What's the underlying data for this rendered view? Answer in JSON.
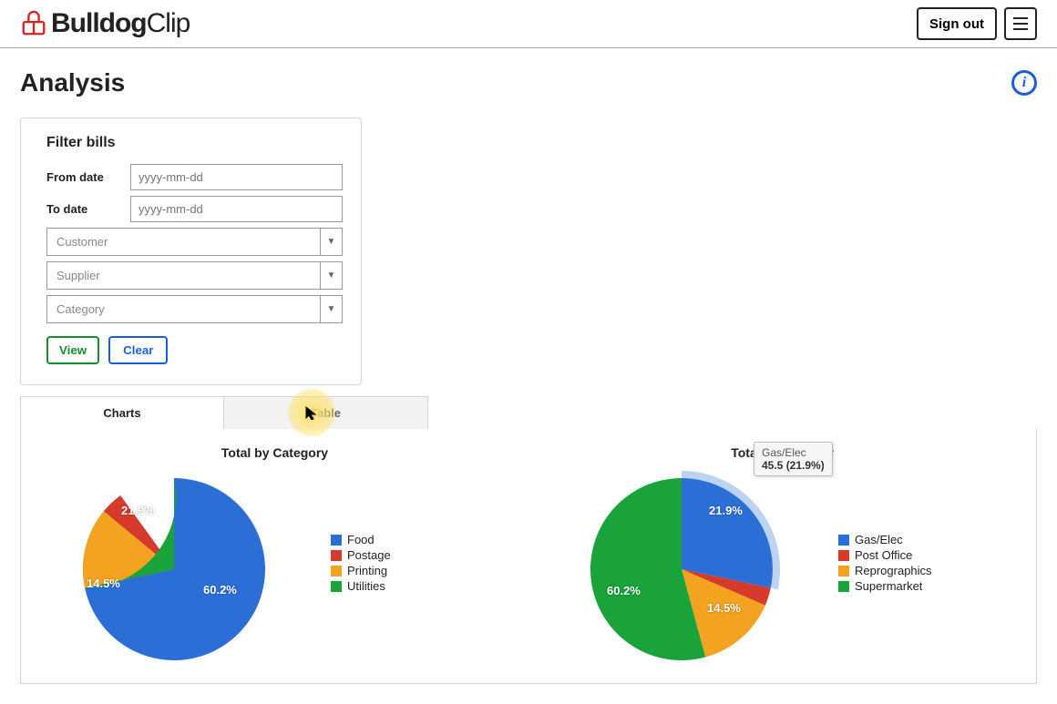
{
  "header": {
    "brand_bold": "Bulldog",
    "brand_light": "Clip",
    "signout": "Sign out"
  },
  "page": {
    "title": "Analysis"
  },
  "filter": {
    "panel_title": "Filter bills",
    "from_label": "From date",
    "from_placeholder": "yyyy-mm-dd",
    "to_label": "To date",
    "to_placeholder": "yyyy-mm-dd",
    "selects": [
      "Customer",
      "Supplier",
      "Category"
    ],
    "view_label": "View",
    "clear_label": "Clear"
  },
  "tabs": {
    "charts": "Charts",
    "table": "Table"
  },
  "tooltip": {
    "name": "Gas/Elec",
    "value_line": "45.5 (21.9%)"
  },
  "chart_data": [
    {
      "type": "pie",
      "title": "Total by Category",
      "series": [
        {
          "name": "Food",
          "pct": 60.2,
          "color": "#2b6fd6",
          "label_shown": "60.2%"
        },
        {
          "name": "Postage",
          "pct": 3.4,
          "color": "#d63a2b",
          "label_shown": ""
        },
        {
          "name": "Printing",
          "pct": 14.5,
          "color": "#f4a321",
          "label_shown": "14.5%"
        },
        {
          "name": "Utilities",
          "pct": 21.9,
          "color": "#19a33a",
          "label_shown": "21.9%"
        }
      ]
    },
    {
      "type": "pie",
      "title": "Total by Supplier",
      "series": [
        {
          "name": "Gas/Elec",
          "pct": 21.9,
          "value": 45.5,
          "color": "#2b6fd6",
          "label_shown": "21.9%",
          "highlighted": true
        },
        {
          "name": "Post Office",
          "pct": 3.4,
          "color": "#d63a2b",
          "label_shown": ""
        },
        {
          "name": "Reprographics",
          "pct": 14.5,
          "color": "#f4a321",
          "label_shown": "14.5%"
        },
        {
          "name": "Supermarket",
          "pct": 60.2,
          "color": "#19a33a",
          "label_shown": "60.2%"
        }
      ]
    }
  ]
}
